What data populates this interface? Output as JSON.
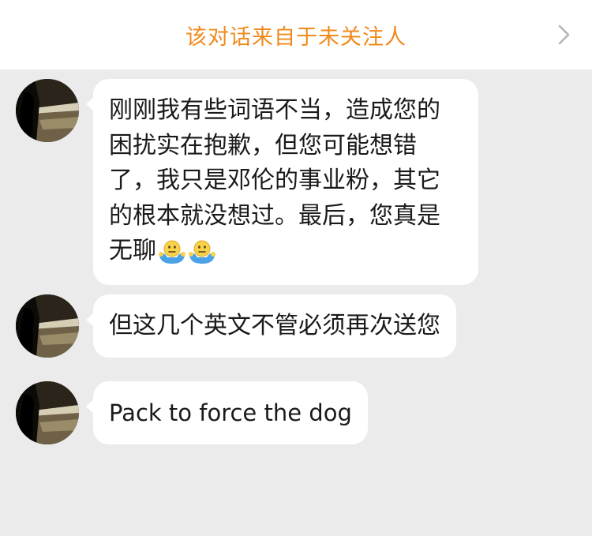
{
  "banner": {
    "text": "该对话来自于未关注人",
    "chevron_icon": "chevron-right-icon"
  },
  "colors": {
    "banner_text": "#f08a1c",
    "background": "#ebebeb",
    "bubble": "#ffffff"
  },
  "messages": [
    {
      "sender": "other",
      "text": "刚刚我有些词语不当，造成您的困扰实在抱歉，但您可能想错了，我只是邓伦的事业粉，其它的根本就没想过。最后，您真是无聊",
      "emoji": [
        "shrug-emoji",
        "shrug-emoji"
      ]
    },
    {
      "sender": "other",
      "text": "但这几个英文不管必须再次送您"
    },
    {
      "sender": "other",
      "text": "Pack to force the dog"
    }
  ]
}
